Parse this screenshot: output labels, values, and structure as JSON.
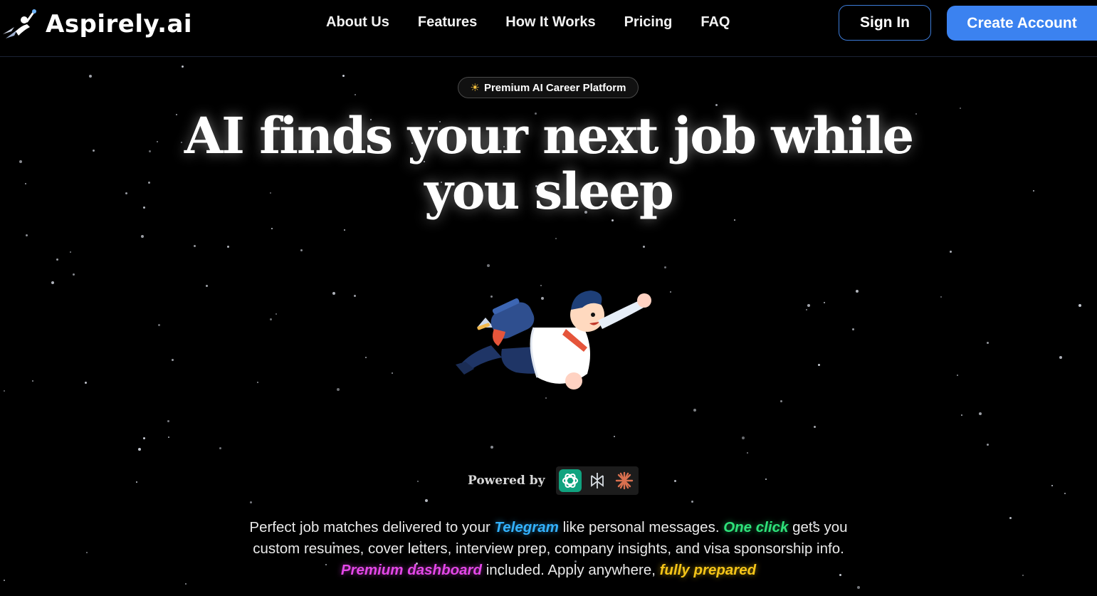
{
  "brand": {
    "name": "Aspirely.ai",
    "logo_icon": "rocket-person-icon"
  },
  "nav": {
    "items": [
      "About Us",
      "Features",
      "How It Works",
      "Pricing",
      "FAQ"
    ]
  },
  "auth": {
    "sign_in": "Sign In",
    "create_account": "Create Account"
  },
  "hero": {
    "badge": {
      "icon": "sun-icon",
      "label": "Premium AI Career Platform"
    },
    "headline": "AI finds your next job while you sleep",
    "illustration": "flying-jetpack-man-illustration",
    "powered_by": {
      "label": "Powered by",
      "logos": [
        "openai-logo-icon",
        "perplexity-logo-icon",
        "claude-logo-icon"
      ]
    },
    "description": {
      "part1": "Perfect job matches delivered to your ",
      "highlight1": "Telegram",
      "part2": " like personal messages. ",
      "highlight2": "One click",
      "part3": " gets you custom resumes, cover letters, interview prep, company insights, and visa sponsorship info. ",
      "highlight3": "Premium dashboard",
      "part4": " included. Apply anywhere, ",
      "highlight4": "fully prepared"
    }
  },
  "colors": {
    "background": "#000000",
    "accent_blue": "#3b82f0",
    "telegram": "#33b2ff",
    "one_click": "#2ee27a",
    "premium": "#e447e8",
    "prepared": "#f5c518"
  }
}
